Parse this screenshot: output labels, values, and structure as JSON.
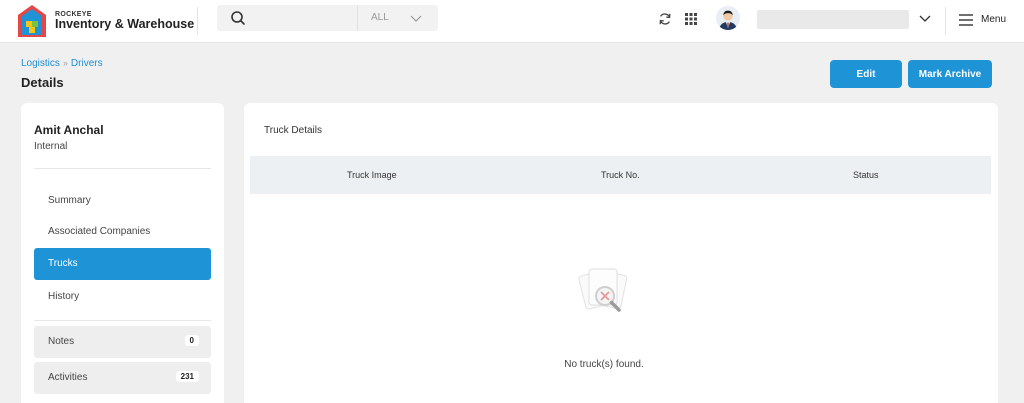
{
  "brand": {
    "small": "ROCKEYE",
    "name": "Inventory & Warehouse"
  },
  "search": {
    "placeholder": "",
    "scope": "ALL"
  },
  "header": {
    "menu_label": "Menu"
  },
  "breadcrumb": {
    "items": [
      "Logistics",
      "Drivers"
    ]
  },
  "page": {
    "title": "Details"
  },
  "actions": {
    "edit_label": "Edit",
    "archive_label": "Mark Archive"
  },
  "profile": {
    "name": "Amit Anchal",
    "type": "Internal"
  },
  "sidebar": {
    "items": [
      {
        "label": "Summary",
        "active": false
      },
      {
        "label": "Associated Companies",
        "active": false
      },
      {
        "label": "Trucks",
        "active": true
      },
      {
        "label": "History",
        "active": false
      }
    ],
    "stats": [
      {
        "label": "Notes",
        "count": "0"
      },
      {
        "label": "Activities",
        "count": "231"
      }
    ]
  },
  "main": {
    "title": "Truck Details",
    "columns": [
      "Truck Image",
      "Truck No.",
      "Status"
    ],
    "empty_text": "No truck(s) found."
  },
  "colors": {
    "accent": "#1e94d6",
    "page_bg": "#f0f0f0",
    "table_header": "#edf0f2"
  },
  "icons": [
    "logo-icon",
    "search-icon",
    "chevron-down-icon",
    "refresh-icon",
    "apps-grid-icon",
    "avatar",
    "hamburger-icon",
    "no-results-icon"
  ]
}
